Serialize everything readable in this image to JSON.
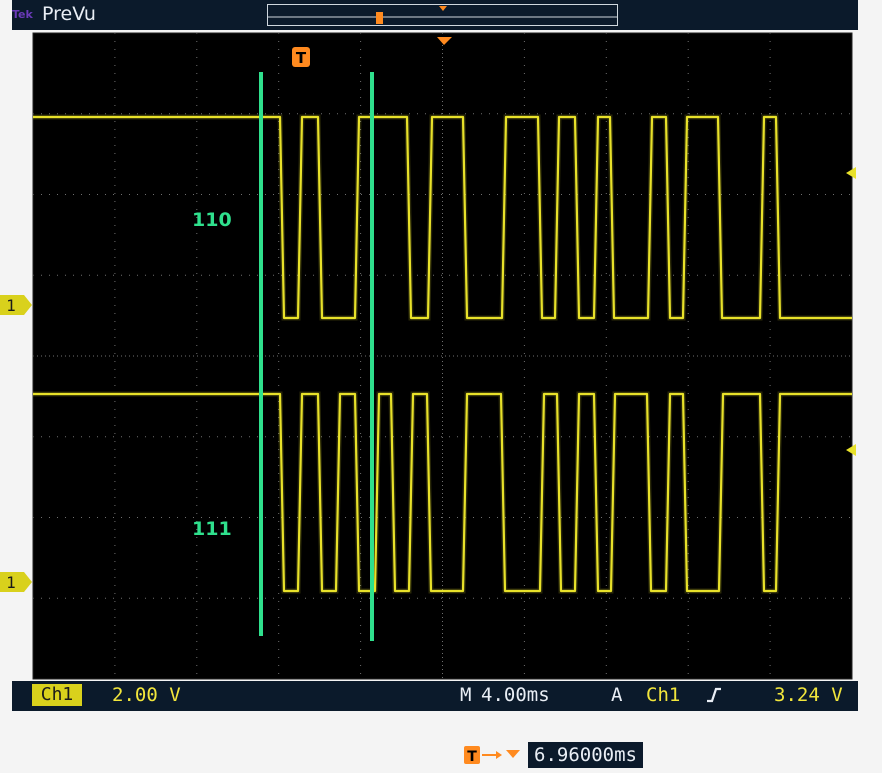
{
  "header": {
    "brand": "Tek",
    "mode": "PreVu"
  },
  "cursors": {
    "top_label": "110",
    "bottom_label": "111"
  },
  "markers": {
    "ch1_top": "1",
    "ch1_bottom": "1",
    "trigger_position": "T"
  },
  "readout": {
    "channel": "Ch1",
    "vertical_scale": "2.00 V",
    "timebase_label": "M",
    "timebase": "4.00ms",
    "trigger_mode": "A",
    "trigger_source": "Ch1",
    "trigger_slope_icon": "rising-edge-icon",
    "trigger_level": "3.24 V",
    "delay_icon": "trigger-delay-icon",
    "delay": "6.96000ms"
  },
  "colors": {
    "screen": "#000000",
    "graticule": "#6f6f6f",
    "trace": "#e8e12a",
    "cursor": "#2fe08d",
    "trigger": "#ff8a1f"
  }
}
